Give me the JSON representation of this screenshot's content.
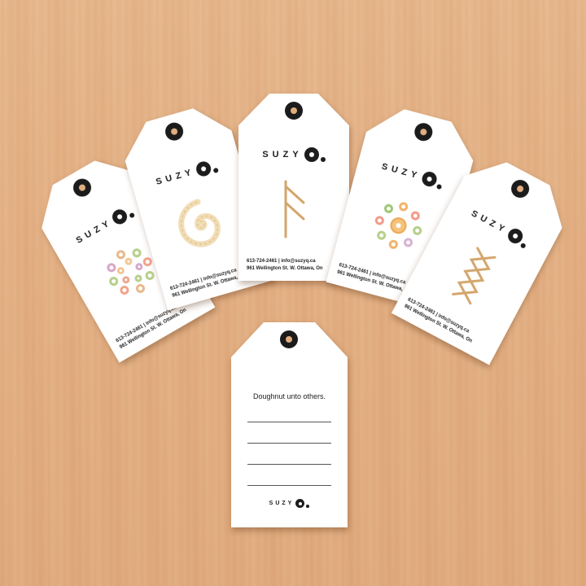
{
  "brand": {
    "name": "SUZY"
  },
  "contact": {
    "line1": "613-724-2461  |  info@suzyq.ca",
    "line2": "961 Wellington St. W. Ottawa, On"
  },
  "tags": [
    {
      "art": "pinwheel-cereal"
    },
    {
      "art": "spiral-pasta"
    },
    {
      "art": "f-rune-sticks"
    },
    {
      "art": "flower-cereal"
    },
    {
      "art": "zigzag-sticks"
    }
  ],
  "back_tag": {
    "tagline": "Doughnut unto others.",
    "blank_lines": 4
  },
  "colors": {
    "wood": "#e3ae82",
    "ink": "#1c1c1c",
    "card": "#ffffff"
  }
}
